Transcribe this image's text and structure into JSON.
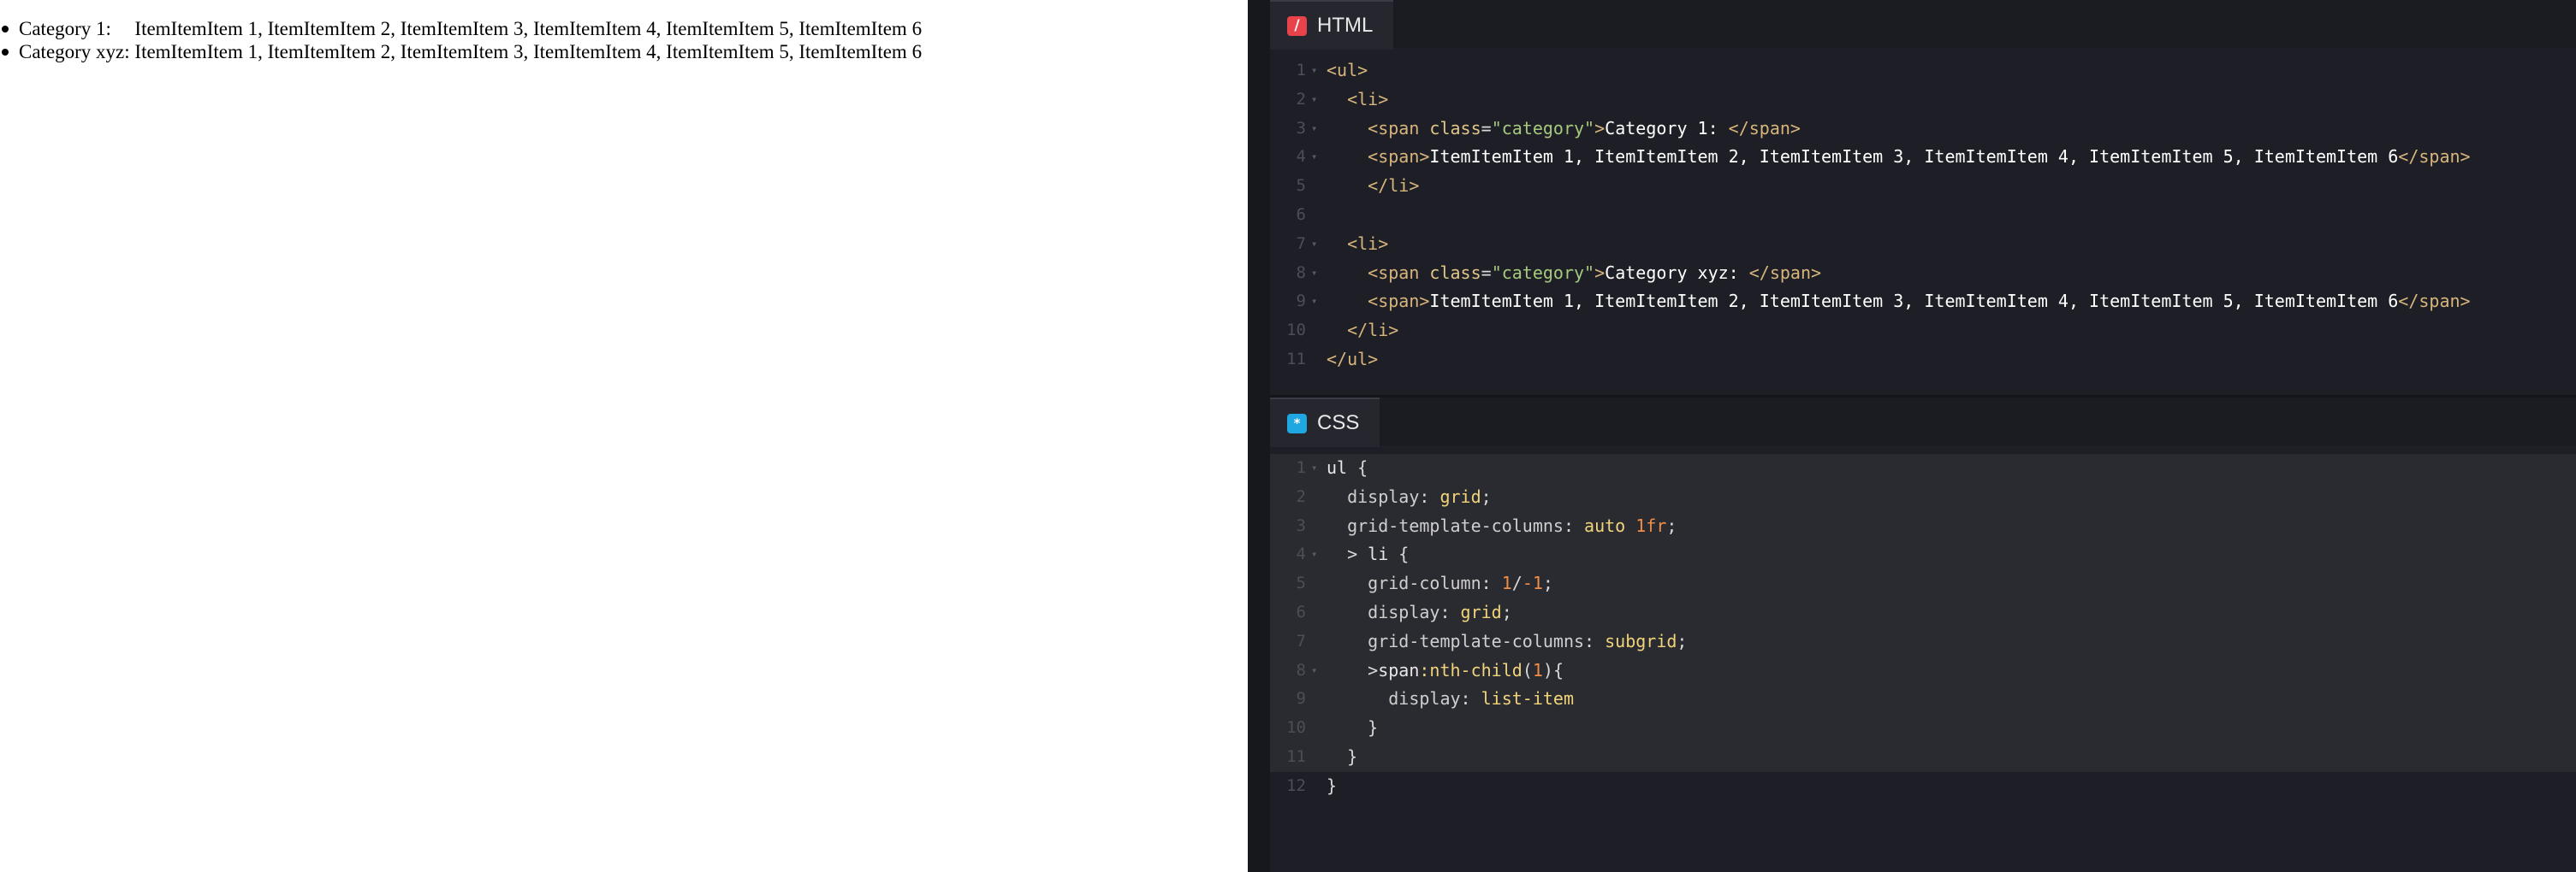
{
  "preview": {
    "items": [
      {
        "category": "Category 1: ",
        "items": "ItemItemItem 1, ItemItemItem 2, ItemItemItem 3, ItemItemItem 4, ItemItemItem 5, ItemItemItem 6"
      },
      {
        "category": "Category xyz: ",
        "items": "ItemItemItem 1, ItemItemItem 2, ItemItemItem 3, ItemItemItem 4, ItemItemItem 5, ItemItemItem 6"
      }
    ]
  },
  "html_editor": {
    "tab_label": "HTML",
    "tab_icon": "html-icon",
    "lines": [
      [
        [
          "tag",
          "<ul>"
        ]
      ],
      [
        [
          "txt",
          "  "
        ],
        [
          "tag",
          "<li>"
        ]
      ],
      [
        [
          "txt",
          "    "
        ],
        [
          "tag",
          "<span "
        ],
        [
          "attr",
          "class"
        ],
        [
          "punc",
          "="
        ],
        [
          "str",
          "\"category\""
        ],
        [
          "tag",
          ">"
        ],
        [
          "txt",
          "Category 1: "
        ],
        [
          "tag",
          "</span>"
        ]
      ],
      [
        [
          "txt",
          "    "
        ],
        [
          "tag",
          "<span>"
        ],
        [
          "txt",
          "ItemItemItem 1, ItemItemItem 2, ItemItemItem 3, ItemItemItem 4, ItemItemItem 5, ItemItemItem 6"
        ],
        [
          "tag",
          "</span>"
        ]
      ],
      [
        [
          "txt",
          "    "
        ],
        [
          "tag",
          "</li>"
        ]
      ],
      [],
      [
        [
          "txt",
          "  "
        ],
        [
          "tag",
          "<li>"
        ]
      ],
      [
        [
          "txt",
          "    "
        ],
        [
          "tag",
          "<span "
        ],
        [
          "attr",
          "class"
        ],
        [
          "punc",
          "="
        ],
        [
          "str",
          "\"category\""
        ],
        [
          "tag",
          ">"
        ],
        [
          "txt",
          "Category xyz: "
        ],
        [
          "tag",
          "</span>"
        ]
      ],
      [
        [
          "txt",
          "    "
        ],
        [
          "tag",
          "<span>"
        ],
        [
          "txt",
          "ItemItemItem 1, ItemItemItem 2, ItemItemItem 3, ItemItemItem 4, ItemItemItem 5, ItemItemItem 6"
        ],
        [
          "tag",
          "</span>"
        ]
      ],
      [
        [
          "txt",
          "  "
        ],
        [
          "tag",
          "</li>"
        ]
      ],
      [
        [
          "tag",
          "</ul>"
        ]
      ]
    ],
    "folds": [
      1,
      2,
      3,
      4,
      7,
      8,
      9
    ]
  },
  "css_editor": {
    "tab_label": "CSS",
    "tab_icon": "css-icon",
    "lines": [
      [
        [
          "sel",
          "ul "
        ],
        [
          "punc",
          "{"
        ]
      ],
      [
        [
          "prop",
          "  display"
        ],
        [
          "punc",
          ": "
        ],
        [
          "val",
          "grid"
        ],
        [
          "punc",
          ";"
        ]
      ],
      [
        [
          "prop",
          "  grid-template-columns"
        ],
        [
          "punc",
          ": "
        ],
        [
          "val",
          "auto "
        ],
        [
          "num",
          "1fr"
        ],
        [
          "punc",
          ";"
        ]
      ],
      [
        [
          "punc",
          "  > "
        ],
        [
          "sel",
          "li "
        ],
        [
          "punc",
          "{"
        ]
      ],
      [
        [
          "prop",
          "    grid-column"
        ],
        [
          "punc",
          ": "
        ],
        [
          "num",
          "1"
        ],
        [
          "punc",
          "/"
        ],
        [
          "num",
          "-1"
        ],
        [
          "punc",
          ";"
        ]
      ],
      [
        [
          "prop",
          "    display"
        ],
        [
          "punc",
          ": "
        ],
        [
          "val",
          "grid"
        ],
        [
          "punc",
          ";"
        ]
      ],
      [
        [
          "prop",
          "    grid-template-columns"
        ],
        [
          "punc",
          ": "
        ],
        [
          "val",
          "subgrid"
        ],
        [
          "punc",
          ";"
        ]
      ],
      [
        [
          "punc",
          "    >"
        ],
        [
          "sel",
          "span"
        ],
        [
          "val",
          ":nth-child"
        ],
        [
          "punc",
          "("
        ],
        [
          "num",
          "1"
        ],
        [
          "punc",
          "){"
        ]
      ],
      [
        [
          "prop",
          "      display"
        ],
        [
          "punc",
          ": "
        ],
        [
          "val",
          "list-item"
        ]
      ],
      [
        [
          "punc",
          "    }"
        ]
      ],
      [
        [
          "punc",
          "  }"
        ]
      ],
      [
        [
          "punc",
          "}"
        ]
      ]
    ],
    "folds": [
      1,
      4,
      8
    ],
    "highlighted": [
      1,
      2,
      3,
      4,
      5,
      6,
      7,
      8,
      9,
      10,
      11
    ]
  }
}
